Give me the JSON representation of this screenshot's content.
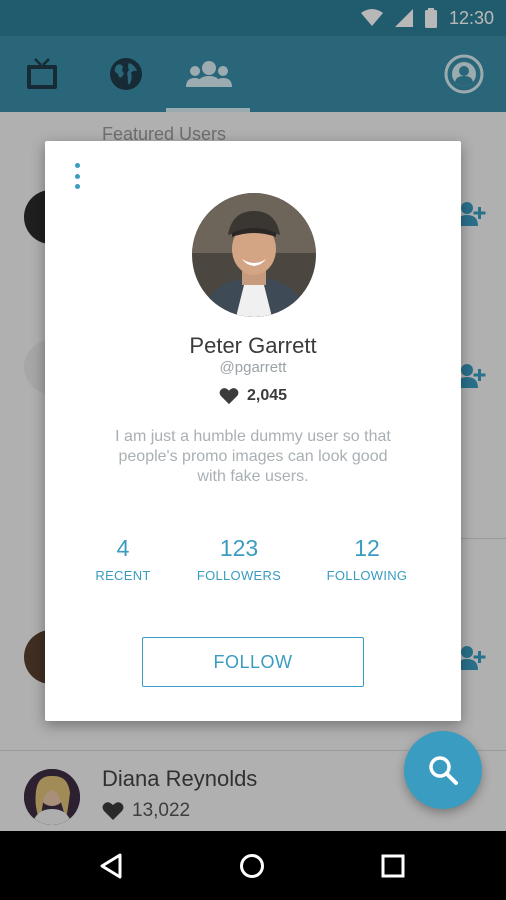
{
  "status_bar": {
    "time": "12:30"
  },
  "tabs": [
    {
      "name": "tv",
      "icon": "tv-icon"
    },
    {
      "name": "globe",
      "icon": "globe-icon"
    },
    {
      "name": "users",
      "icon": "users-icon",
      "selected": true
    }
  ],
  "background": {
    "section_title": "Featured Users",
    "visible_user": {
      "name": "Diana Reynolds",
      "likes": "13,022"
    }
  },
  "profile": {
    "name": "Peter Garrett",
    "handle": "@pgarrett",
    "likes": "2,045",
    "bio": "I am just a humble dummy user so that people's promo images can look good with fake users.",
    "stats": [
      {
        "value": "4",
        "label": "RECENT"
      },
      {
        "value": "123",
        "label": "FOLLOWERS"
      },
      {
        "value": "12",
        "label": "FOLLOWING"
      }
    ],
    "follow_label": "FOLLOW"
  },
  "colors": {
    "primary": "#3a8ea9",
    "accent": "#3a9cc0",
    "status_bar": "#2f7f99"
  }
}
